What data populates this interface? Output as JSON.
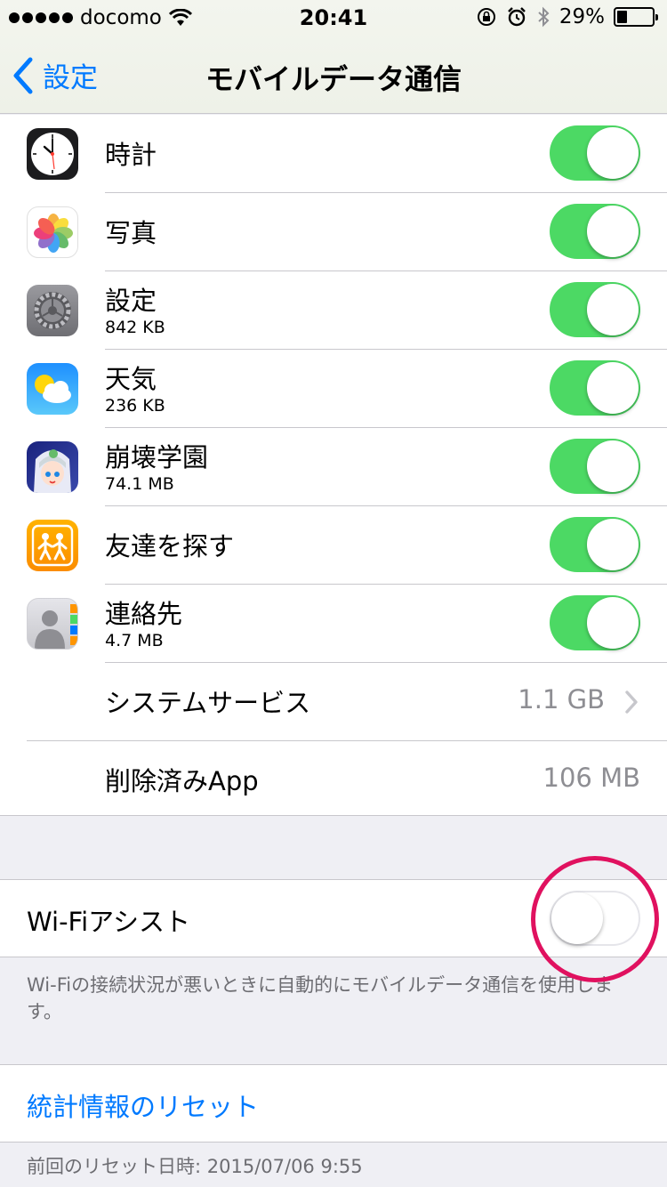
{
  "status_bar": {
    "carrier": "docomo",
    "time": "20:41",
    "battery_percent": "29%",
    "battery_level": 0.29,
    "icons": [
      "signal-dots-icon",
      "wifi-icon",
      "rotation-lock-icon",
      "alarm-icon",
      "bluetooth-icon",
      "battery-icon"
    ]
  },
  "nav": {
    "back_label": "設定",
    "title": "モバイルデータ通信"
  },
  "apps": [
    {
      "name": "時計",
      "size": "",
      "enabled": true,
      "icon": "clock-app-icon"
    },
    {
      "name": "写真",
      "size": "",
      "enabled": true,
      "icon": "photos-app-icon"
    },
    {
      "name": "設定",
      "size": "842 KB",
      "enabled": true,
      "icon": "settings-app-icon"
    },
    {
      "name": "天気",
      "size": "236 KB",
      "enabled": true,
      "icon": "weather-app-icon"
    },
    {
      "name": "崩壊学園",
      "size": "74.1 MB",
      "enabled": true,
      "icon": "houkai-gakuen-app-icon"
    },
    {
      "name": "友達を探す",
      "size": "",
      "enabled": true,
      "icon": "find-friends-app-icon"
    },
    {
      "name": "連絡先",
      "size": "4.7 MB",
      "enabled": true,
      "icon": "contacts-app-icon"
    }
  ],
  "system_services": {
    "label": "システムサービス",
    "value": "1.1 GB"
  },
  "deleted_apps": {
    "label": "削除済みApp",
    "value": "106 MB"
  },
  "wifi_assist": {
    "label": "Wi-Fiアシスト",
    "enabled": false,
    "description": "Wi-Fiの接続状況が悪いときに自動的にモバイルデータ通信を使用します。"
  },
  "reset": {
    "label": "統計情報のリセット",
    "last_reset": "前回のリセット日時: 2015/07/06 9:55"
  },
  "colors": {
    "accent": "#007aff",
    "toggle_on": "#4cd964",
    "highlight_circle": "#e0115f"
  }
}
